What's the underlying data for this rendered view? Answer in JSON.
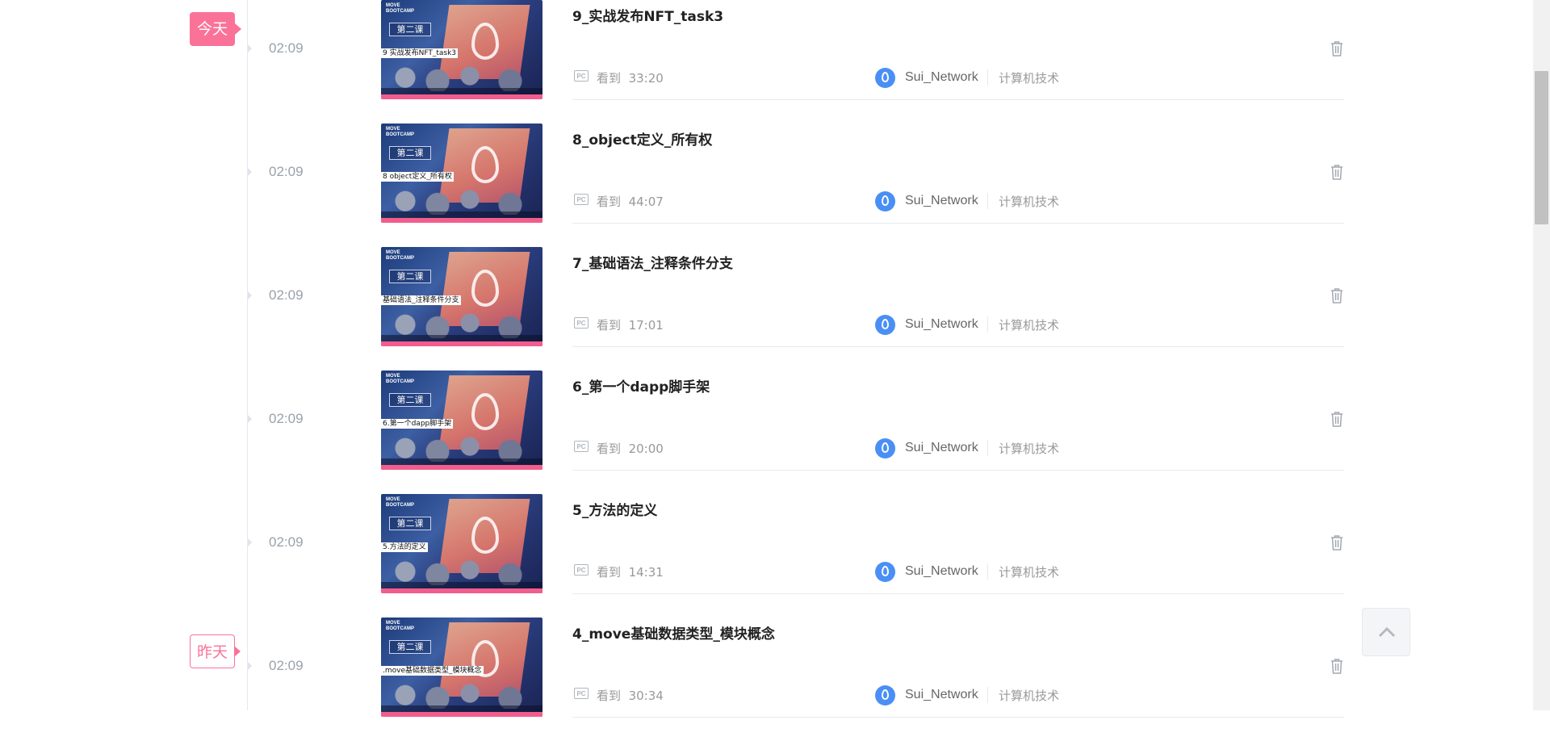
{
  "timeline": {
    "today_label": "今天",
    "yesterday_label": "昨天"
  },
  "items": [
    {
      "time": "02:09",
      "title": "9_实战发布NFT_task3",
      "thumb_caption": "9 实战发布NFT_task3",
      "device": "PC",
      "watched_label": "看到",
      "watched_position": "33:20",
      "up_name": "Sui_Network",
      "category": "计算机技术"
    },
    {
      "time": "02:09",
      "title": "8_object定义_所有权",
      "thumb_caption": "8 object定义_所有权",
      "device": "PC",
      "watched_label": "看到",
      "watched_position": "44:07",
      "up_name": "Sui_Network",
      "category": "计算机技术"
    },
    {
      "time": "02:09",
      "title": "7_基础语法_注释条件分支",
      "thumb_caption": "基础语法_注释条件分支",
      "device": "PC",
      "watched_label": "看到",
      "watched_position": "17:01",
      "up_name": "Sui_Network",
      "category": "计算机技术"
    },
    {
      "time": "02:09",
      "title": "6_第一个dapp脚手架",
      "thumb_caption": "6.第一个dapp脚手架",
      "device": "PC",
      "watched_label": "看到",
      "watched_position": "20:00",
      "up_name": "Sui_Network",
      "category": "计算机技术"
    },
    {
      "time": "02:09",
      "title": "5_方法的定义",
      "thumb_caption": "5.方法的定义",
      "device": "PC",
      "watched_label": "看到",
      "watched_position": "14:31",
      "up_name": "Sui_Network",
      "category": "计算机技术"
    },
    {
      "time": "02:09",
      "title": "4_move基础数据类型_模块概念",
      "thumb_caption": ".move基础数据类型_模块概念",
      "device": "PC",
      "watched_label": "看到",
      "watched_position": "30:34",
      "up_name": "Sui_Network",
      "category": "计算机技术"
    }
  ],
  "thumbnail": {
    "brand": "MOVE BOOTCAMP",
    "lesson": "第二课"
  },
  "icons": {
    "device": "pc-icon",
    "up_avatar": "sui-logo-avatar",
    "delete": "trash-icon",
    "back_to_top": "chevron-up-icon"
  },
  "colors": {
    "accent": "#fb7299",
    "progress": "#f25d8e",
    "avatar": "#4a8ff5"
  }
}
